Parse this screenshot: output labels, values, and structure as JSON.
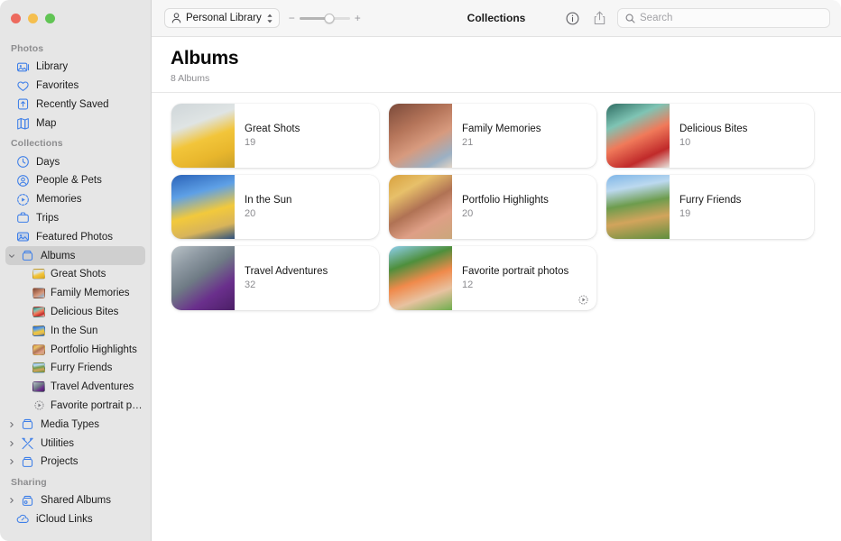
{
  "window": {
    "traffic_lights": [
      "close",
      "minimize",
      "zoom"
    ],
    "colors": {
      "close": "#ed6a5e",
      "minimize": "#f5bf4f",
      "zoom": "#61c454",
      "accent": "#3e7fe8",
      "sidebar_bg": "#e6e6e6"
    }
  },
  "toolbar": {
    "library_label": "Personal Library",
    "library_icon": "person-icon",
    "library_chevron_icon": "chevron-up-down-icon",
    "zoom_out_label": "−",
    "zoom_in_label": "+",
    "zoom_slider_value": 60,
    "title": "Collections",
    "info_icon": "info-circle-icon",
    "share_icon": "share-icon",
    "search": {
      "icon": "search-icon",
      "placeholder": "Search",
      "value": ""
    }
  },
  "sidebar": {
    "sections": [
      {
        "title": "Photos",
        "items": [
          {
            "label": "Library",
            "icon": "photos-library-icon",
            "selected": false,
            "level": 0
          },
          {
            "label": "Favorites",
            "icon": "heart-icon",
            "selected": false,
            "level": 0
          },
          {
            "label": "Recently Saved",
            "icon": "recently-saved-icon",
            "selected": false,
            "level": 0
          },
          {
            "label": "Map",
            "icon": "map-icon",
            "selected": false,
            "level": 0
          }
        ]
      },
      {
        "title": "Collections",
        "items": [
          {
            "label": "Days",
            "icon": "clock-icon",
            "selected": false,
            "level": 0
          },
          {
            "label": "People & Pets",
            "icon": "person-circle-icon",
            "selected": false,
            "level": 0
          },
          {
            "label": "Memories",
            "icon": "memories-play-icon",
            "selected": false,
            "level": 0
          },
          {
            "label": "Trips",
            "icon": "suitcase-icon",
            "selected": false,
            "level": 0
          },
          {
            "label": "Featured Photos",
            "icon": "featured-photo-icon",
            "selected": false,
            "level": 0
          },
          {
            "label": "Albums",
            "icon": "album-box-icon",
            "selected": true,
            "level": 0,
            "disclosure": "expanded"
          },
          {
            "label": "Great Shots",
            "icon": "album-thumbnail",
            "selected": false,
            "level": 1,
            "thumb": "great-shots"
          },
          {
            "label": "Family Memories",
            "icon": "album-thumbnail",
            "selected": false,
            "level": 1,
            "thumb": "family-memories"
          },
          {
            "label": "Delicious Bites",
            "icon": "album-thumbnail",
            "selected": false,
            "level": 1,
            "thumb": "delicious-bites"
          },
          {
            "label": "In the Sun",
            "icon": "album-thumbnail",
            "selected": false,
            "level": 1,
            "thumb": "in-the-sun"
          },
          {
            "label": "Portfolio Highlights",
            "icon": "album-thumbnail",
            "selected": false,
            "level": 1,
            "thumb": "portfolio-highlights"
          },
          {
            "label": "Furry Friends",
            "icon": "album-thumbnail",
            "selected": false,
            "level": 1,
            "thumb": "furry-friends"
          },
          {
            "label": "Travel Adventures",
            "icon": "album-thumbnail",
            "selected": false,
            "level": 1,
            "thumb": "travel-adventures"
          },
          {
            "label": "Favorite portrait photos",
            "icon": "smart-album-gear-icon",
            "selected": false,
            "level": 1
          },
          {
            "label": "Media Types",
            "icon": "album-box-icon",
            "selected": false,
            "level": 0,
            "disclosure": "collapsed"
          },
          {
            "label": "Utilities",
            "icon": "utilities-icon",
            "selected": false,
            "level": 0,
            "disclosure": "collapsed"
          },
          {
            "label": "Projects",
            "icon": "album-box-icon",
            "selected": false,
            "level": 0,
            "disclosure": "collapsed"
          }
        ]
      },
      {
        "title": "Sharing",
        "items": [
          {
            "label": "Shared Albums",
            "icon": "shared-album-icon",
            "selected": false,
            "level": 0,
            "disclosure": "collapsed"
          },
          {
            "label": "iCloud Links",
            "icon": "icloud-link-icon",
            "selected": false,
            "level": 0
          }
        ]
      }
    ]
  },
  "main": {
    "title": "Albums",
    "subtitle": "8 Albums",
    "albums": [
      {
        "name": "Great Shots",
        "count": "19",
        "thumb": "great-shots",
        "smart": false
      },
      {
        "name": "Family Memories",
        "count": "21",
        "thumb": "family-memories",
        "smart": false
      },
      {
        "name": "Delicious Bites",
        "count": "10",
        "thumb": "delicious-bites",
        "smart": false
      },
      {
        "name": "In the Sun",
        "count": "20",
        "thumb": "in-the-sun",
        "smart": false
      },
      {
        "name": "Portfolio Highlights",
        "count": "20",
        "thumb": "portfolio-highlights",
        "smart": false
      },
      {
        "name": "Furry Friends",
        "count": "19",
        "thumb": "furry-friends",
        "smart": false
      },
      {
        "name": "Travel Adventures",
        "count": "32",
        "thumb": "travel-adventures",
        "smart": false
      },
      {
        "name": "Favorite portrait photos",
        "count": "12",
        "thumb": "favorite-portraits",
        "smart": true,
        "smart_icon": "smart-album-gear-icon"
      }
    ]
  }
}
